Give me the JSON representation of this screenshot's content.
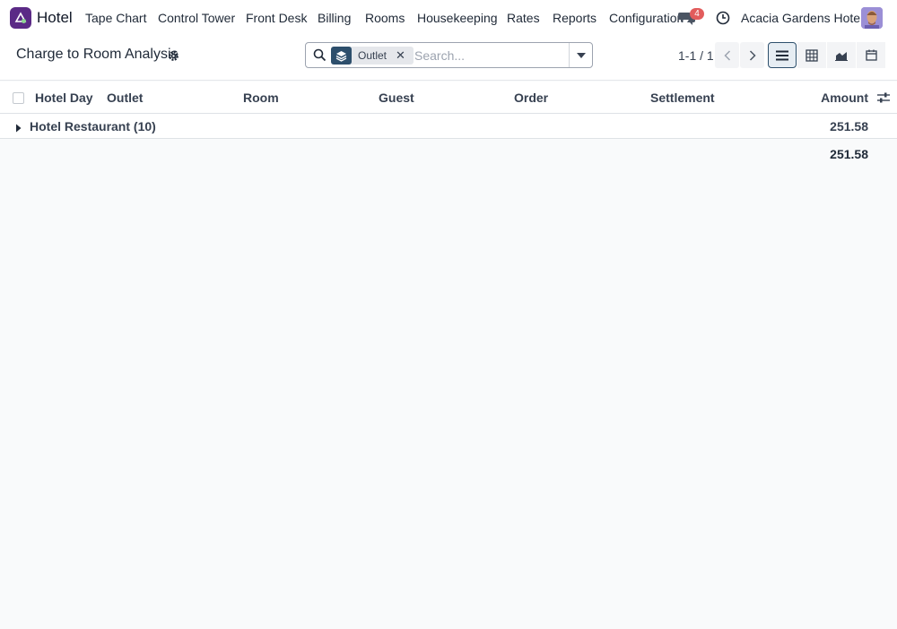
{
  "app": {
    "name": "Hotel",
    "logo_icon": "hotel-app-icon"
  },
  "menu": [
    "Tape Chart",
    "Control Tower",
    "Front Desk",
    "Billing",
    "Rooms",
    "Housekeeping",
    "Rates",
    "Reports",
    "Configuration"
  ],
  "systray": {
    "messages_count": "4",
    "company": "Acacia Gardens Hotel",
    "badge_color": "#e25c5c"
  },
  "control_panel": {
    "title": "Charge to Room Analysis",
    "search": {
      "facet_label": "Outlet",
      "facet_icon": "layers-icon",
      "placeholder": "Search..."
    },
    "pager": "1-1 / 1",
    "views": [
      "list",
      "pivot",
      "graph",
      "calendar"
    ],
    "active_view": "list"
  },
  "table": {
    "columns": [
      "Hotel Day",
      "Outlet",
      "Room",
      "Guest",
      "Order",
      "Settlement",
      "Amount"
    ],
    "groups": [
      {
        "label": "Hotel Restaurant (10)",
        "amount": "251.58"
      }
    ],
    "total": "251.58"
  },
  "colors": {
    "accent": "#2d4f6c",
    "brand": "#5b2a86",
    "background": "#f9fafb"
  }
}
